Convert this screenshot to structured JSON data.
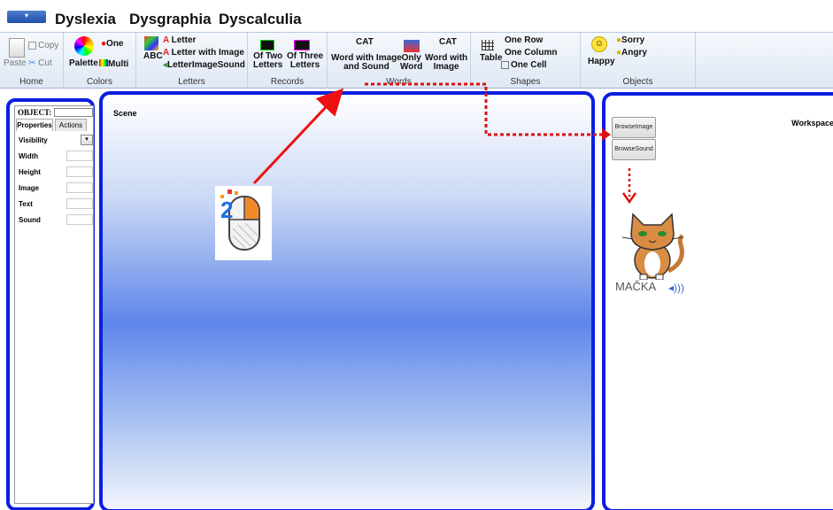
{
  "tabs": [
    "Dyslexia",
    "Dysgraphia",
    "Dyscalculia"
  ],
  "ribbon": {
    "home": {
      "label": "Home",
      "paste": "Paste",
      "copy": "Copy",
      "cut": "Cut"
    },
    "colors": {
      "label": "Colors",
      "palette": "Palette",
      "one": "One",
      "multi": "Multi"
    },
    "letters": {
      "label": "Letters",
      "abc": "ABC",
      "letter": "Letter",
      "letter_with_image": "Letter with Image",
      "letter_image_sound": "LetterImageSound"
    },
    "records": {
      "label": "Records",
      "two_line1": "Of Two",
      "two_line2": "Letters",
      "three_line1": "Of Three",
      "three_line2": "Letters"
    },
    "words": {
      "label": "Words",
      "cat_text": "CAT",
      "wis_line1": "Word with Image",
      "wis_line2": "and Sound",
      "only_line1": "Only",
      "only_line2": "Word",
      "wi_line1": "Word with",
      "wi_line2": "Image"
    },
    "shapes": {
      "label": "Shapes",
      "table": "Table",
      "one_row": "One Row",
      "one_column": "One Column",
      "one_cell": "One Cell"
    },
    "objects": {
      "label": "Objects",
      "happy": "Happy",
      "sorry": "Sorry",
      "angry": "Angry"
    }
  },
  "properties": {
    "object_label": "OBJECT:",
    "tab_properties": "Properties",
    "tab_actions": "Actions",
    "rows": [
      "Visibility",
      "Width",
      "Height",
      "Image",
      "Text",
      "Sound"
    ]
  },
  "scene": {
    "label": "Scene"
  },
  "workspace": {
    "label": "Workspace",
    "browse_image": "BrowseImage",
    "browse_sound": "BrowseSound",
    "cat_word": "MAČKA"
  },
  "colors": {
    "panel_border": "#0b1fe0",
    "arrow_solid": "#ee1111",
    "arrow_dotted": "#dd1111"
  }
}
